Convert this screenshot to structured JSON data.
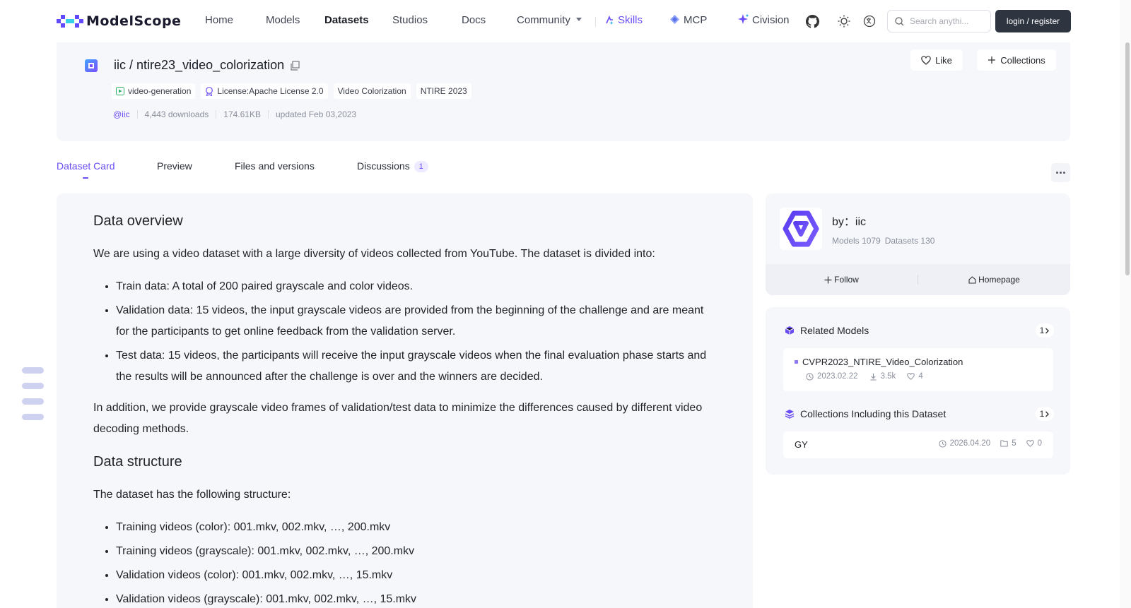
{
  "nav": {
    "logo_text": "ModelScope",
    "items": [
      {
        "label": "Home"
      },
      {
        "label": "Models"
      },
      {
        "label": "Datasets"
      },
      {
        "label": "Studios"
      },
      {
        "label": "Docs"
      },
      {
        "label": "Community"
      },
      {
        "label": "Skills"
      },
      {
        "label": "MCP"
      },
      {
        "label": "Civision"
      }
    ],
    "search_placeholder": "Search anythi...",
    "login_label": "login / register",
    "accent_color": "#6a4cf5"
  },
  "dataset": {
    "owner": "iic",
    "separator": "/",
    "name": "ntire23_video_colorization",
    "tags": [
      {
        "label": "video-generation",
        "icon": "video-generation-icon"
      },
      {
        "label": "License:Apache License 2.0",
        "icon": "license-icon"
      },
      {
        "label": "Video Colorization"
      },
      {
        "label": "NTIRE 2023"
      }
    ],
    "meta": {
      "author": "@iic",
      "downloads": "4,443 downloads",
      "size": "174.61KB",
      "updated": "updated Feb 03,2023"
    },
    "like_label": "Like",
    "collections_label": "Collections"
  },
  "tabs": [
    {
      "label": "Dataset Card"
    },
    {
      "label": "Preview"
    },
    {
      "label": "Files and versions"
    },
    {
      "label": "Discussions",
      "badge": "1"
    }
  ],
  "card": {
    "h_overview": "Data overview",
    "p_intro": "We are using a video dataset with a large diversity of videos collected from YouTube. The dataset is divided into:",
    "split_items": [
      "Train data: A total of 200 paired grayscale and color videos.",
      "Validation data: 15 videos, the input grayscale videos are provided from the beginning of the challenge and are meant for the participants to get online feedback from the validation server.",
      "Test data: 15 videos, the participants will receive the input grayscale videos when the final evaluation phase starts and the results will be announced after the challenge is over and the winners are decided."
    ],
    "p_addition": "In addition, we provide grayscale video frames of validation/test data to minimize the differences caused by different video decoding methods.",
    "h_structure": "Data structure",
    "p_structure": "The dataset has the following structure:",
    "structure_items": [
      "Training videos (color): 001.mkv, 002.mkv, …, 200.mkv",
      "Training videos (grayscale): 001.mkv, 002.mkv, …, 200.mkv",
      "Validation videos (color): 001.mkv, 002.mkv, …, 15.mkv",
      "Validation videos (grayscale): 001.mkv, 002.mkv, …, 15.mkv"
    ]
  },
  "org": {
    "by_label": "by：iic",
    "models": "Models 1079",
    "datasets": "Datasets 130",
    "follow_label": "Follow",
    "homepage_label": "Homepage"
  },
  "related_models": {
    "title": "Related Models",
    "count": "1",
    "items": [
      {
        "name": "CVPR2023_NTIRE_Video_Colorization",
        "date": "2023.02.22",
        "downloads": "3.5k",
        "likes": "4"
      }
    ]
  },
  "collections": {
    "title": "Collections Including this Dataset",
    "count": "1",
    "items": [
      {
        "name": "GY",
        "date": "2026.04.20",
        "items": "5",
        "likes": "0"
      }
    ]
  }
}
